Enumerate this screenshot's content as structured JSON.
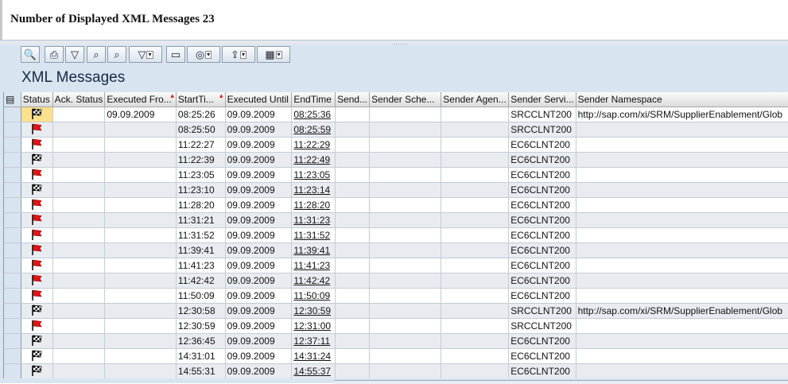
{
  "header": {
    "title": "Number of Displayed XML Messages 23"
  },
  "toolbar": {
    "buttons": [
      {
        "name": "details-button",
        "icon": "magnifier-icon",
        "glyph": "🔍",
        "dropdown": false
      },
      {
        "name": "print-button",
        "icon": "printer-icon",
        "glyph": "⎙",
        "dropdown": false
      },
      {
        "name": "filter-button",
        "icon": "filter-icon",
        "glyph": "▽",
        "dropdown": false
      },
      {
        "name": "find-button",
        "icon": "binoculars-icon",
        "glyph": "⌕",
        "dropdown": false
      },
      {
        "name": "find-next-button",
        "icon": "binoculars-next-icon",
        "glyph": "⌕",
        "dropdown": false
      },
      {
        "name": "set-filter-button",
        "icon": "set-filter-icon",
        "glyph": "▽",
        "dropdown": true
      },
      {
        "name": "print-preview-button",
        "icon": "document-icon",
        "glyph": "▭",
        "dropdown": false
      },
      {
        "name": "view-button",
        "icon": "view-icon",
        "glyph": "◎",
        "dropdown": true
      },
      {
        "name": "export-button",
        "icon": "export-icon",
        "glyph": "⇪",
        "dropdown": true
      },
      {
        "name": "layout-button",
        "icon": "layout-grid-icon",
        "glyph": "▦",
        "dropdown": true
      }
    ]
  },
  "grid": {
    "title": "XML Messages",
    "columns": [
      {
        "label": "",
        "sort": false
      },
      {
        "label": "Status",
        "sort": false
      },
      {
        "label": "Ack. Status",
        "sort": false
      },
      {
        "label": "Executed Fro...",
        "sort": true
      },
      {
        "label": "StartTi...",
        "sort": true
      },
      {
        "label": "Executed Until",
        "sort": false
      },
      {
        "label": "EndTime",
        "sort": false
      },
      {
        "label": "Send...",
        "sort": false
      },
      {
        "label": "Sender Sche...",
        "sort": false
      },
      {
        "label": "Sender Agen...",
        "sort": false
      },
      {
        "label": "Sender Servi...",
        "sort": false
      },
      {
        "label": "Sender Namespace",
        "sort": false
      }
    ],
    "rows": [
      {
        "status": "checkered-flag",
        "executed_from": "09.09.2009",
        "start": "08:25:26",
        "until": "09.09.2009",
        "end": "08:25:36",
        "service": "SRCCLNT200",
        "namespace": "http://sap.com/xi/SRM/SupplierEnablement/Glob"
      },
      {
        "status": "red-flag",
        "executed_from": "",
        "start": "08:25:50",
        "until": "09.09.2009",
        "end": "08:25:59",
        "service": "SRCCLNT200",
        "namespace": ""
      },
      {
        "status": "red-flag",
        "executed_from": "",
        "start": "11:22:27",
        "until": "09.09.2009",
        "end": "11:22:29",
        "service": "EC6CLNT200",
        "namespace": ""
      },
      {
        "status": "checkered-flag",
        "executed_from": "",
        "start": "11:22:39",
        "until": "09.09.2009",
        "end": "11:22:49",
        "service": "EC6CLNT200",
        "namespace": ""
      },
      {
        "status": "red-flag",
        "executed_from": "",
        "start": "11:23:05",
        "until": "09.09.2009",
        "end": "11:23:05",
        "service": "EC6CLNT200",
        "namespace": ""
      },
      {
        "status": "checkered-flag",
        "executed_from": "",
        "start": "11:23:10",
        "until": "09.09.2009",
        "end": "11:23:14",
        "service": "EC6CLNT200",
        "namespace": ""
      },
      {
        "status": "red-flag",
        "executed_from": "",
        "start": "11:28:20",
        "until": "09.09.2009",
        "end": "11:28:20",
        "service": "EC6CLNT200",
        "namespace": ""
      },
      {
        "status": "red-flag",
        "executed_from": "",
        "start": "11:31:21",
        "until": "09.09.2009",
        "end": "11:31:23",
        "service": "EC6CLNT200",
        "namespace": ""
      },
      {
        "status": "red-flag",
        "executed_from": "",
        "start": "11:31:52",
        "until": "09.09.2009",
        "end": "11:31:52",
        "service": "EC6CLNT200",
        "namespace": ""
      },
      {
        "status": "red-flag",
        "executed_from": "",
        "start": "11:39:41",
        "until": "09.09.2009",
        "end": "11:39:41",
        "service": "EC6CLNT200",
        "namespace": ""
      },
      {
        "status": "red-flag",
        "executed_from": "",
        "start": "11:41:23",
        "until": "09.09.2009",
        "end": "11:41:23",
        "service": "EC6CLNT200",
        "namespace": ""
      },
      {
        "status": "red-flag",
        "executed_from": "",
        "start": "11:42:42",
        "until": "09.09.2009",
        "end": "11:42:42",
        "service": "EC6CLNT200",
        "namespace": ""
      },
      {
        "status": "red-flag",
        "executed_from": "",
        "start": "11:50:09",
        "until": "09.09.2009",
        "end": "11:50:09",
        "service": "EC6CLNT200",
        "namespace": ""
      },
      {
        "status": "checkered-flag",
        "executed_from": "",
        "start": "12:30:58",
        "until": "09.09.2009",
        "end": "12:30:59",
        "service": "SRCCLNT200",
        "namespace": "http://sap.com/xi/SRM/SupplierEnablement/Glob"
      },
      {
        "status": "red-flag",
        "executed_from": "",
        "start": "12:30:59",
        "until": "09.09.2009",
        "end": "12:31:00",
        "service": "SRCCLNT200",
        "namespace": ""
      },
      {
        "status": "checkered-flag",
        "executed_from": "",
        "start": "12:36:45",
        "until": "09.09.2009",
        "end": "12:37:11",
        "service": "EC6CLNT200",
        "namespace": ""
      },
      {
        "status": "checkered-flag",
        "executed_from": "",
        "start": "14:31:01",
        "until": "09.09.2009",
        "end": "14:31:24",
        "service": "EC6CLNT200",
        "namespace": ""
      },
      {
        "status": "checkered-flag",
        "executed_from": "",
        "start": "14:55:31",
        "until": "09.09.2009",
        "end": "14:55:37",
        "service": "EC6CLNT200",
        "namespace": ""
      }
    ]
  },
  "colors": {
    "red_flag": "#e11414",
    "accent": "#d9e4f1",
    "selected_status": "#fce08b"
  }
}
